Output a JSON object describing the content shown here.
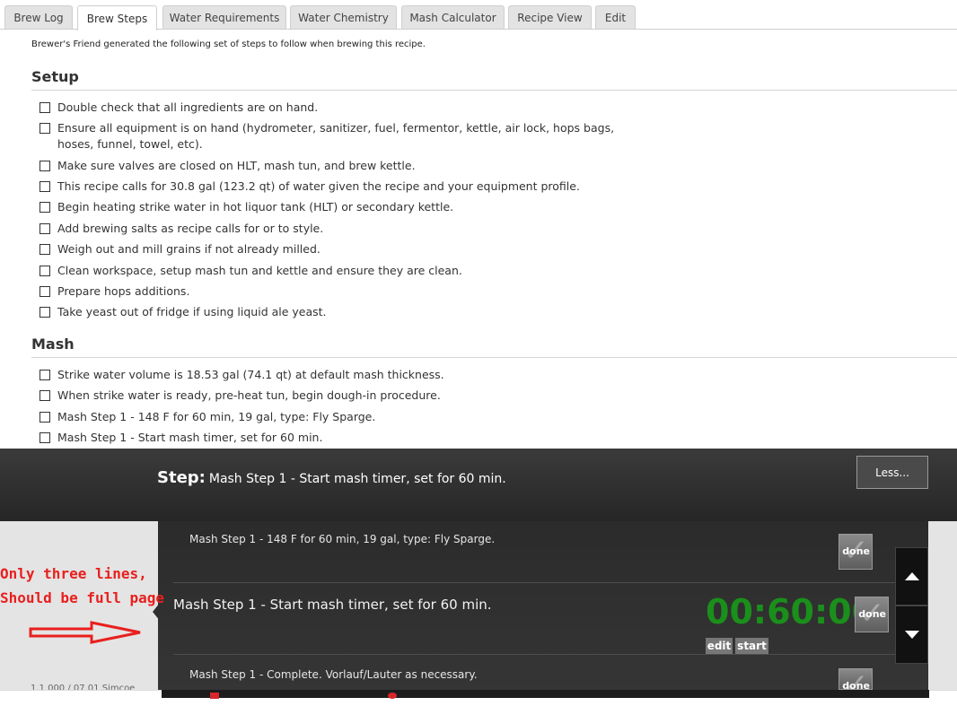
{
  "tabs": [
    {
      "label": "Brew Log",
      "active": false
    },
    {
      "label": "Brew Steps",
      "active": true
    },
    {
      "label": "Water Requirements",
      "active": false
    },
    {
      "label": "Water Chemistry",
      "active": false
    },
    {
      "label": "Mash Calculator",
      "active": false
    },
    {
      "label": "Recipe View",
      "active": false
    },
    {
      "label": "Edit",
      "active": false
    }
  ],
  "intro": "Brewer's Friend generated the following set of steps to follow when brewing this recipe.",
  "setup": {
    "title": "Setup",
    "steps": [
      "Double check that all ingredients are on hand.",
      "Ensure all equipment is on hand (hydrometer, sanitizer, fuel, fermentor, kettle, air lock, hops bags, hoses, funnel, towel, etc).",
      "Make sure valves are closed on HLT, mash tun, and brew kettle.",
      "This recipe calls for 30.8 gal (123.2 qt) of water given the recipe and your equipment profile.",
      "Begin heating strike water in hot liquor tank (HLT) or secondary kettle.",
      "Add brewing salts as recipe calls for or to style.",
      "Weigh out and mill grains if not already milled.",
      "Clean workspace, setup mash tun and kettle and ensure they are clean.",
      "Prepare hops additions.",
      "Take yeast out of fridge if using liquid ale yeast."
    ]
  },
  "mash": {
    "title": "Mash",
    "steps": [
      "Strike water volume is 18.53 gal (74.1 qt) at default mash thickness.",
      "When strike water is ready, pre-heat tun, begin dough-in procedure.",
      "Mash Step 1 - 148 F for 60 min, 19 gal, type: Fly Sparge.",
      "Mash Step 1 - Start mash timer, set for 60 min."
    ]
  },
  "overlay": {
    "step_label": "Step:",
    "step_text": "Mash Step 1 - Start mash timer, set for 60 min.",
    "less_label": "Less...",
    "prev_step": "Mash Step 1 - 148 F for 60 min, 19 gal, type: Fly Sparge.",
    "current_step": "Mash Step 1 - Start mash timer, set for 60 min.",
    "next_step": "Mash Step 1 - Complete. Vorlauf/Lauter as necessary.",
    "timer": "00:60:00",
    "done_label": "done",
    "edit_label": "edit",
    "start_label": "start"
  },
  "annotation": {
    "line1": "Only three lines,",
    "line2": "Should be full page",
    "color": "#e8201e"
  },
  "peek_text": "1.1 000 / 07 01 Simcoe",
  "colors": {
    "timer_green": "#1b8f1b",
    "overlay_dark": "#2b2b2b",
    "tab_inactive": "#e3e3e3"
  }
}
